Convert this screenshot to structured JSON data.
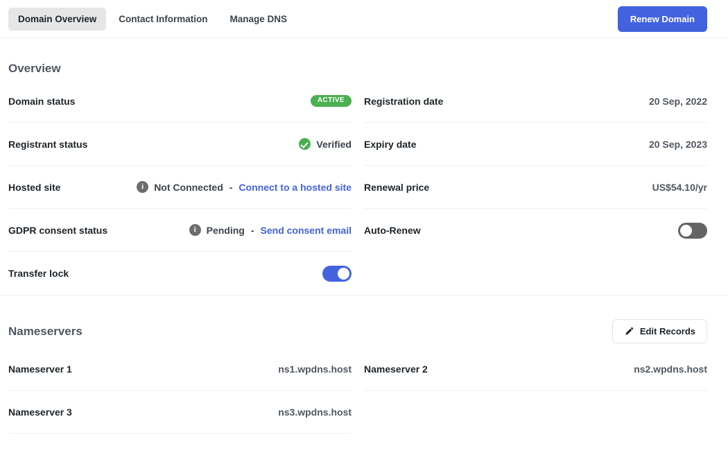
{
  "header": {
    "tabs": [
      {
        "label": "Domain Overview",
        "active": true
      },
      {
        "label": "Contact Information",
        "active": false
      },
      {
        "label": "Manage DNS",
        "active": false
      }
    ],
    "renew_button": "Renew Domain"
  },
  "overview": {
    "title": "Overview",
    "left_rows": [
      {
        "label": "Domain status",
        "badge": "Active"
      },
      {
        "label": "Registrant status",
        "icon": "check-circle-icon",
        "value": "Verified"
      },
      {
        "label": "Hosted site",
        "icon": "info-icon",
        "status": "Not Connected",
        "separator": "-",
        "link": "Connect to a hosted site"
      },
      {
        "label": "GDPR consent status",
        "icon": "info-icon",
        "status": "Pending",
        "separator": "-",
        "link": "Send consent email"
      },
      {
        "label": "Transfer lock",
        "toggle": "on"
      }
    ],
    "right_rows": [
      {
        "label": "Registration date",
        "value": "20 Sep, 2022"
      },
      {
        "label": "Expiry date",
        "value": "20 Sep, 2023"
      },
      {
        "label": "Renewal price",
        "value": "US$54.10/yr"
      },
      {
        "label": "Auto-Renew",
        "toggle": "off"
      }
    ]
  },
  "nameservers": {
    "title": "Nameservers",
    "edit_button": "Edit Records",
    "left_rows": [
      {
        "label": "Nameserver 1",
        "value": "ns1.wpdns.host"
      },
      {
        "label": "Nameserver 3",
        "value": "ns3.wpdns.host"
      }
    ],
    "right_rows": [
      {
        "label": "Nameserver 2",
        "value": "ns2.wpdns.host"
      }
    ]
  },
  "colors": {
    "accent_blue": "#4262e0",
    "status_green": "#4caf50",
    "toggle_off_gray": "#646464",
    "divider": "#f0f0f1"
  }
}
